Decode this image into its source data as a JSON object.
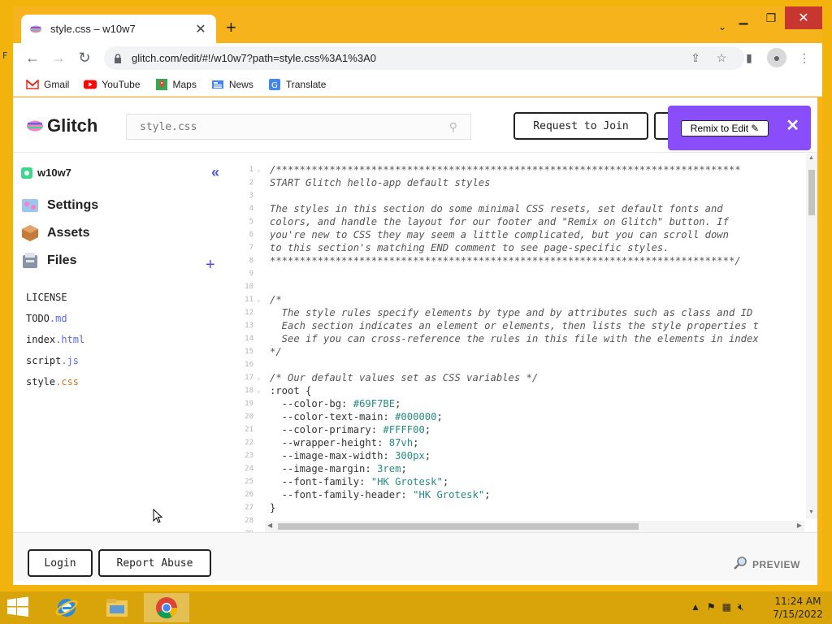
{
  "browser": {
    "tab_title": "style.css – w10w7",
    "url": "glitch.com/edit/#!/w10w7?path=style.css%3A1%3A0",
    "bookmarks": [
      {
        "label": "Gmail",
        "icon": "gmail-icon"
      },
      {
        "label": "YouTube",
        "icon": "youtube-icon"
      },
      {
        "label": "Maps",
        "icon": "maps-icon"
      },
      {
        "label": "News",
        "icon": "news-icon"
      },
      {
        "label": "Translate",
        "icon": "translate-icon"
      }
    ]
  },
  "header": {
    "logo_text": "Glitch",
    "search_placeholder": "style.css",
    "request_join_label": "Request to Join",
    "remix_label": "Remix to Edit"
  },
  "sidebar": {
    "project_name": "w10w7",
    "nav": [
      {
        "label": "Settings",
        "icon": "settings-icon"
      },
      {
        "label": "Assets",
        "icon": "assets-icon"
      },
      {
        "label": "Files",
        "icon": "files-icon"
      }
    ],
    "files": [
      {
        "name": "LICENSE",
        "ext": ""
      },
      {
        "name": "TODO",
        "ext": ".md"
      },
      {
        "name": "index",
        "ext": ".html"
      },
      {
        "name": "script",
        "ext": ".js"
      },
      {
        "name": "style",
        "ext": ".css"
      }
    ]
  },
  "editor": {
    "lines": [
      {
        "n": "1",
        "fold": true,
        "parts": [
          [
            "c",
            "/******************************************************************************"
          ]
        ]
      },
      {
        "n": "2",
        "parts": [
          [
            "c",
            "START Glitch hello-app default styles"
          ]
        ]
      },
      {
        "n": "3",
        "parts": []
      },
      {
        "n": "4",
        "parts": [
          [
            "c",
            "The styles in this section do some minimal CSS resets, set default fonts and"
          ]
        ]
      },
      {
        "n": "5",
        "parts": [
          [
            "c",
            "colors, and handle the layout for our footer and \"Remix on Glitch\" button. If"
          ]
        ]
      },
      {
        "n": "6",
        "parts": [
          [
            "c",
            "you're new to CSS they may seem a little complicated, but you can scroll down"
          ]
        ]
      },
      {
        "n": "7",
        "parts": [
          [
            "c",
            "to this section's matching END comment to see page-specific styles."
          ]
        ]
      },
      {
        "n": "8",
        "parts": [
          [
            "c",
            "******************************************************************************/"
          ]
        ]
      },
      {
        "n": "9",
        "parts": []
      },
      {
        "n": "10",
        "parts": []
      },
      {
        "n": "11",
        "fold": true,
        "parts": [
          [
            "c",
            "/*"
          ]
        ]
      },
      {
        "n": "12",
        "parts": [
          [
            "c",
            "  The style rules specify elements by type and by attributes such as class and ID"
          ]
        ]
      },
      {
        "n": "13",
        "parts": [
          [
            "c",
            "  Each section indicates an element or elements, then lists the style properties t"
          ]
        ]
      },
      {
        "n": "14",
        "parts": [
          [
            "c",
            "  See if you can cross-reference the rules in this file with the elements in index"
          ]
        ]
      },
      {
        "n": "15",
        "parts": [
          [
            "c",
            "*/"
          ]
        ]
      },
      {
        "n": "16",
        "parts": []
      },
      {
        "n": "17",
        "fold": true,
        "parts": [
          [
            "c",
            "/* Our default values set as CSS variables */"
          ]
        ]
      },
      {
        "n": "18",
        "fold": true,
        "parts": [
          [
            "s",
            ":root {"
          ]
        ]
      },
      {
        "n": "19",
        "parts": [
          [
            "s",
            "  --color-bg: "
          ],
          [
            "v",
            "#69F7BE"
          ],
          [
            "s",
            ";"
          ]
        ]
      },
      {
        "n": "20",
        "parts": [
          [
            "s",
            "  --color-text-main: "
          ],
          [
            "v",
            "#000000"
          ],
          [
            "s",
            ";"
          ]
        ]
      },
      {
        "n": "21",
        "parts": [
          [
            "s",
            "  --color-primary: "
          ],
          [
            "v",
            "#FFFF00"
          ],
          [
            "s",
            ";"
          ]
        ]
      },
      {
        "n": "22",
        "parts": [
          [
            "s",
            "  --wrapper-height: "
          ],
          [
            "v",
            "87vh"
          ],
          [
            "s",
            ";"
          ]
        ]
      },
      {
        "n": "23",
        "parts": [
          [
            "s",
            "  --image-max-width: "
          ],
          [
            "v",
            "300px"
          ],
          [
            "s",
            ";"
          ]
        ]
      },
      {
        "n": "24",
        "parts": [
          [
            "s",
            "  --image-margin: "
          ],
          [
            "v",
            "3rem"
          ],
          [
            "s",
            ";"
          ]
        ]
      },
      {
        "n": "25",
        "parts": [
          [
            "s",
            "  --font-family: "
          ],
          [
            "v",
            "\"HK Grotesk\""
          ],
          [
            "s",
            ";"
          ]
        ]
      },
      {
        "n": "26",
        "parts": [
          [
            "s",
            "  --font-family-header: "
          ],
          [
            "v",
            "\"HK Grotesk\""
          ],
          [
            "s",
            ";"
          ]
        ]
      },
      {
        "n": "27",
        "parts": [
          [
            "s",
            "}"
          ]
        ]
      },
      {
        "n": "28",
        "parts": []
      },
      {
        "n": "29",
        "parts": []
      }
    ]
  },
  "footer": {
    "login_label": "Login",
    "report_label": "Report Abuse",
    "preview_label": "PREVIEW"
  },
  "taskbar": {
    "time": "11:24 AM",
    "date": "7/15/2022"
  },
  "colors": {
    "remix_purple": "#8a4dfa",
    "desktop_yellow": "#f2b40c",
    "link_blue": "#4b53d9"
  }
}
